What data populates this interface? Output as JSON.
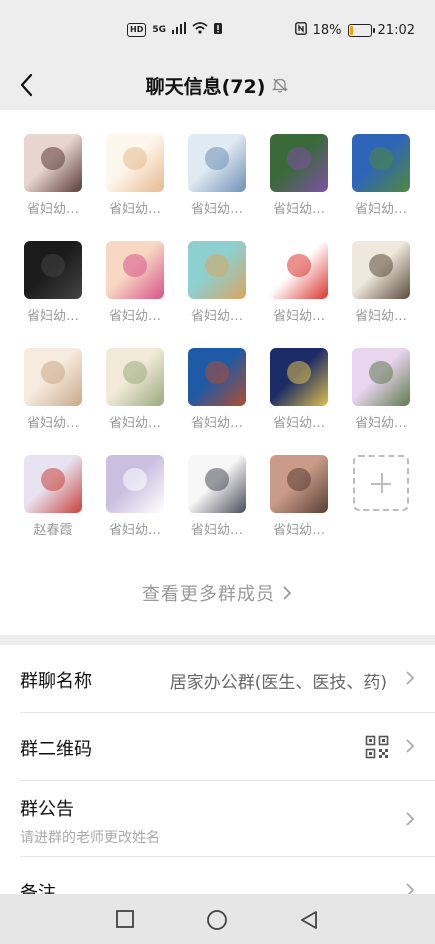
{
  "status_bar": {
    "hd": "HD",
    "network": "5G",
    "battery_percent": "18%",
    "battery_level": 0.18,
    "battery_color": "#f4a000",
    "time": "21:02"
  },
  "header": {
    "title": "聊天信息(72)",
    "back_icon": "back-arrow-icon",
    "mute_icon": "bell-off-icon"
  },
  "members": [
    {
      "name": "省妇幼…",
      "color_a": "#e9d5d0",
      "color_b": "#5b3b36"
    },
    {
      "name": "省妇幼…",
      "color_a": "#fdf6ec",
      "color_b": "#e8b98e"
    },
    {
      "name": "省妇幼…",
      "color_a": "#dfeaf2",
      "color_b": "#6f8fb5"
    },
    {
      "name": "省妇幼…",
      "color_a": "#3b6a3a",
      "color_b": "#7f4fa6"
    },
    {
      "name": "省妇幼…",
      "color_a": "#2f65b8",
      "color_b": "#4f8a3a"
    },
    {
      "name": "省妇幼…",
      "color_a": "#1b1b1b",
      "color_b": "#444"
    },
    {
      "name": "省妇幼…",
      "color_a": "#f7d8c2",
      "color_b": "#d7548b"
    },
    {
      "name": "省妇幼…",
      "color_a": "#8ecfd0",
      "color_b": "#d9a55f"
    },
    {
      "name": "省妇幼…",
      "color_a": "#ffffff",
      "color_b": "#d9352f"
    },
    {
      "name": "省妇幼…",
      "color_a": "#efe8dc",
      "color_b": "#5a4c3c"
    },
    {
      "name": "省妇幼…",
      "color_a": "#f6ebde",
      "color_b": "#caa88a"
    },
    {
      "name": "省妇幼…",
      "color_a": "#f1ead8",
      "color_b": "#9aa97d"
    },
    {
      "name": "省妇幼…",
      "color_a": "#1f5aa6",
      "color_b": "#b04d2f"
    },
    {
      "name": "省妇幼…",
      "color_a": "#1c2c66",
      "color_b": "#e0c04c"
    },
    {
      "name": "省妇幼…",
      "color_a": "#e9d5f0",
      "color_b": "#5f7a4d"
    },
    {
      "name": "赵春霞",
      "color_a": "#e7e3f0",
      "color_b": "#c8413c"
    },
    {
      "name": "省妇幼…",
      "color_a": "#cbbfe0",
      "color_b": "#ffffff"
    },
    {
      "name": "省妇幼…",
      "color_a": "#f7f7f7",
      "color_b": "#4c4c5a"
    },
    {
      "name": "省妇幼…",
      "color_a": "#c99b88",
      "color_b": "#5a3d35"
    }
  ],
  "view_more_label": "查看更多群成员",
  "settings": {
    "group_name": {
      "label": "群聊名称",
      "value": "居家办公群(医生、医技、药)"
    },
    "qr_code": {
      "label": "群二维码",
      "icon": "qr-code-icon"
    },
    "announcement": {
      "label": "群公告",
      "sub": "请进群的老师更改姓名"
    },
    "remark": {
      "label": "备注"
    }
  },
  "nav": {
    "recent_icon": "square-recent-icon",
    "home_icon": "circle-home-icon",
    "back_icon": "triangle-back-icon"
  }
}
